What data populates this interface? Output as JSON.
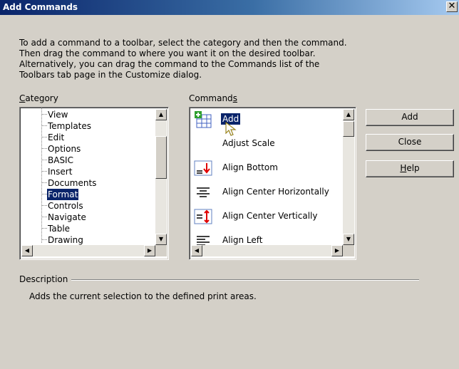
{
  "window": {
    "title": "Add Commands",
    "close_glyph": "✕"
  },
  "intro": [
    "To add a command to a toolbar, select the category and then the command.",
    "Then drag the command to where you want it on the desired toolbar.",
    "Alternatively, you can drag the command to the Commands list of the",
    "Toolbars tab page in the Customize dialog."
  ],
  "category": {
    "label": "Category",
    "items": [
      "View",
      "Templates",
      "Edit",
      "Options",
      "BASIC",
      "Insert",
      "Documents",
      "Format",
      "Controls",
      "Navigate",
      "Table",
      "Drawing"
    ],
    "selected": "Format"
  },
  "commands": {
    "label": "Commands",
    "items": [
      {
        "label": "Add",
        "icon": "add-table-icon",
        "selected": true
      },
      {
        "label": "Adjust Scale",
        "icon": "none",
        "selected": false
      },
      {
        "label": "Align Bottom",
        "icon": "align-bottom-icon",
        "selected": false
      },
      {
        "label": "Align Center Horizontally",
        "icon": "align-center-horizontal-icon",
        "selected": false
      },
      {
        "label": "Align Center Vertically",
        "icon": "align-center-vertical-icon",
        "selected": false
      },
      {
        "label": "Align Left",
        "icon": "align-left-icon",
        "selected": false
      }
    ]
  },
  "buttons": {
    "add": "Add",
    "close": "Close",
    "help": "Help"
  },
  "description": {
    "label": "Description",
    "text": "Adds the current selection to the defined print areas."
  },
  "colors": {
    "selection": "#0a246a",
    "face": "#d4d0c8",
    "red_arrow": "#e00000"
  }
}
